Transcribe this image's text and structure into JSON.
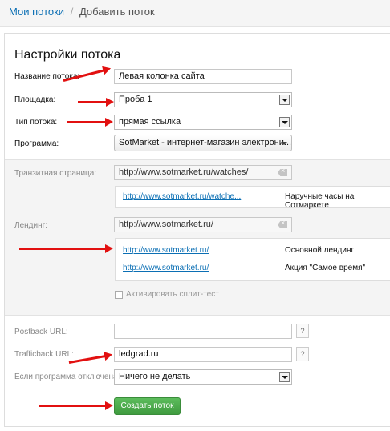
{
  "breadcrumb": {
    "parent": "Мои потоки",
    "separator": "/",
    "current": "Добавить поток"
  },
  "form": {
    "title": "Настройки потока",
    "stream_name": {
      "label": "Название потока:",
      "value": "Левая колонка сайта"
    },
    "platform": {
      "label": "Площадка:",
      "value": "Проба 1"
    },
    "stream_type": {
      "label": "Тип потока:",
      "value": "прямая ссылка"
    },
    "program": {
      "label": "Программа:",
      "value": "SotMarket - интернет-магазин электрони..."
    },
    "transit": {
      "label": "Транзитная страница:",
      "value": "http://www.sotmarket.ru/watches/",
      "links": [
        {
          "url": "http://www.sotmarket.ru/watche...",
          "title": "Наручные часы на Сотмаркете"
        }
      ]
    },
    "landing": {
      "label": "Лендинг:",
      "value": "http://www.sotmarket.ru/",
      "links": [
        {
          "url": "http://www.sotmarket.ru/",
          "title": "Основной лендинг"
        },
        {
          "url": "http://www.sotmarket.ru/",
          "title": "Акция \"Самое время\""
        }
      ]
    },
    "split_test": {
      "label": "Активировать сплит-тест",
      "checked": false
    },
    "postback": {
      "label": "Postback URL:",
      "value": "",
      "help": "?"
    },
    "trafficback": {
      "label": "Trafficback URL:",
      "value": "ledgrad.ru",
      "help": "?"
    },
    "disabled_program": {
      "label": "Если программа отключена:",
      "value": "Ничего не делать"
    },
    "submit_label": "Создать поток"
  },
  "colors": {
    "link": "#0b6fb4",
    "arrow": "#e21010",
    "button": "#4aa84a"
  }
}
